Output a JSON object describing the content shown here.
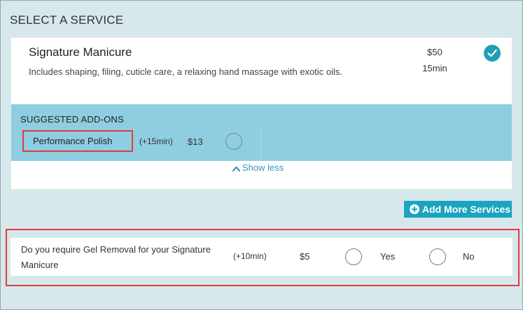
{
  "section": {
    "title": "SELECT A SERVICE"
  },
  "service": {
    "name": "Signature Manicure",
    "description": "Includes shaping, filing, cuticle care, a relaxing hand massage with exotic oils.",
    "price": "$50",
    "duration": "15min",
    "selected": true,
    "check_icon": "check-icon"
  },
  "addons": {
    "title": "SUGGESTED ADD-ONS",
    "items": [
      {
        "name": "Performance Polish",
        "duration": "(+15min)",
        "price": "$13",
        "selected": false
      }
    ],
    "show_less_label": "Show less",
    "show_less_icon": "chevron-up-icon"
  },
  "add_more": {
    "label": "Add More Services",
    "icon": "plus-circle-icon"
  },
  "gel_removal": {
    "question": "Do you require Gel Removal for your Signature Manicure",
    "duration": "(+10min)",
    "price": "$5",
    "yes_label": "Yes",
    "no_label": "No"
  },
  "colors": {
    "background": "#d6e8ec",
    "accent": "#1aa4c0",
    "addons_panel": "#8fcde0",
    "highlight": "#e23b3b",
    "link": "#2f9bbd"
  }
}
